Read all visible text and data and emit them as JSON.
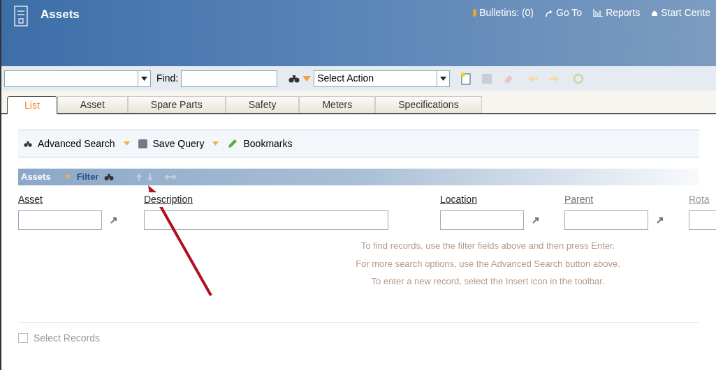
{
  "header": {
    "title": "Assets",
    "links": [
      {
        "kind": "bulletin",
        "label": "Bulletins: (0)"
      },
      {
        "kind": "goto",
        "label": "Go To"
      },
      {
        "kind": "reports",
        "label": "Reports"
      },
      {
        "kind": "start",
        "label": "Start Cente"
      }
    ]
  },
  "toolbar": {
    "find_label": "Find:",
    "action_select": "Select Action"
  },
  "tabs": [
    {
      "label": "List",
      "selected": true
    },
    {
      "label": "Asset",
      "selected": false
    },
    {
      "label": "Spare Parts",
      "selected": false
    },
    {
      "label": "Safety",
      "selected": false
    },
    {
      "label": "Meters",
      "selected": false
    },
    {
      "label": "Specifications",
      "selected": false
    }
  ],
  "query_bar": {
    "advanced_search": "Advanced Search",
    "save_query": "Save Query",
    "bookmarks": "Bookmarks"
  },
  "table": {
    "title": "Assets",
    "filter": "Filter",
    "columns": [
      {
        "label": "Asset",
        "lookup": true
      },
      {
        "label": "Description",
        "lookup": false
      },
      {
        "label": "Location",
        "lookup": true
      },
      {
        "label": "Parent",
        "lookup": true
      },
      {
        "label": "Rota"
      }
    ]
  },
  "messages": [
    "To find records, use the filter fields above and then press Enter.",
    "For more search options, use the Advanced Search button above.",
    "To enter a new record, select the Insert icon in the toolbar."
  ],
  "select_records": {
    "label": "Select Records",
    "checked": false
  }
}
